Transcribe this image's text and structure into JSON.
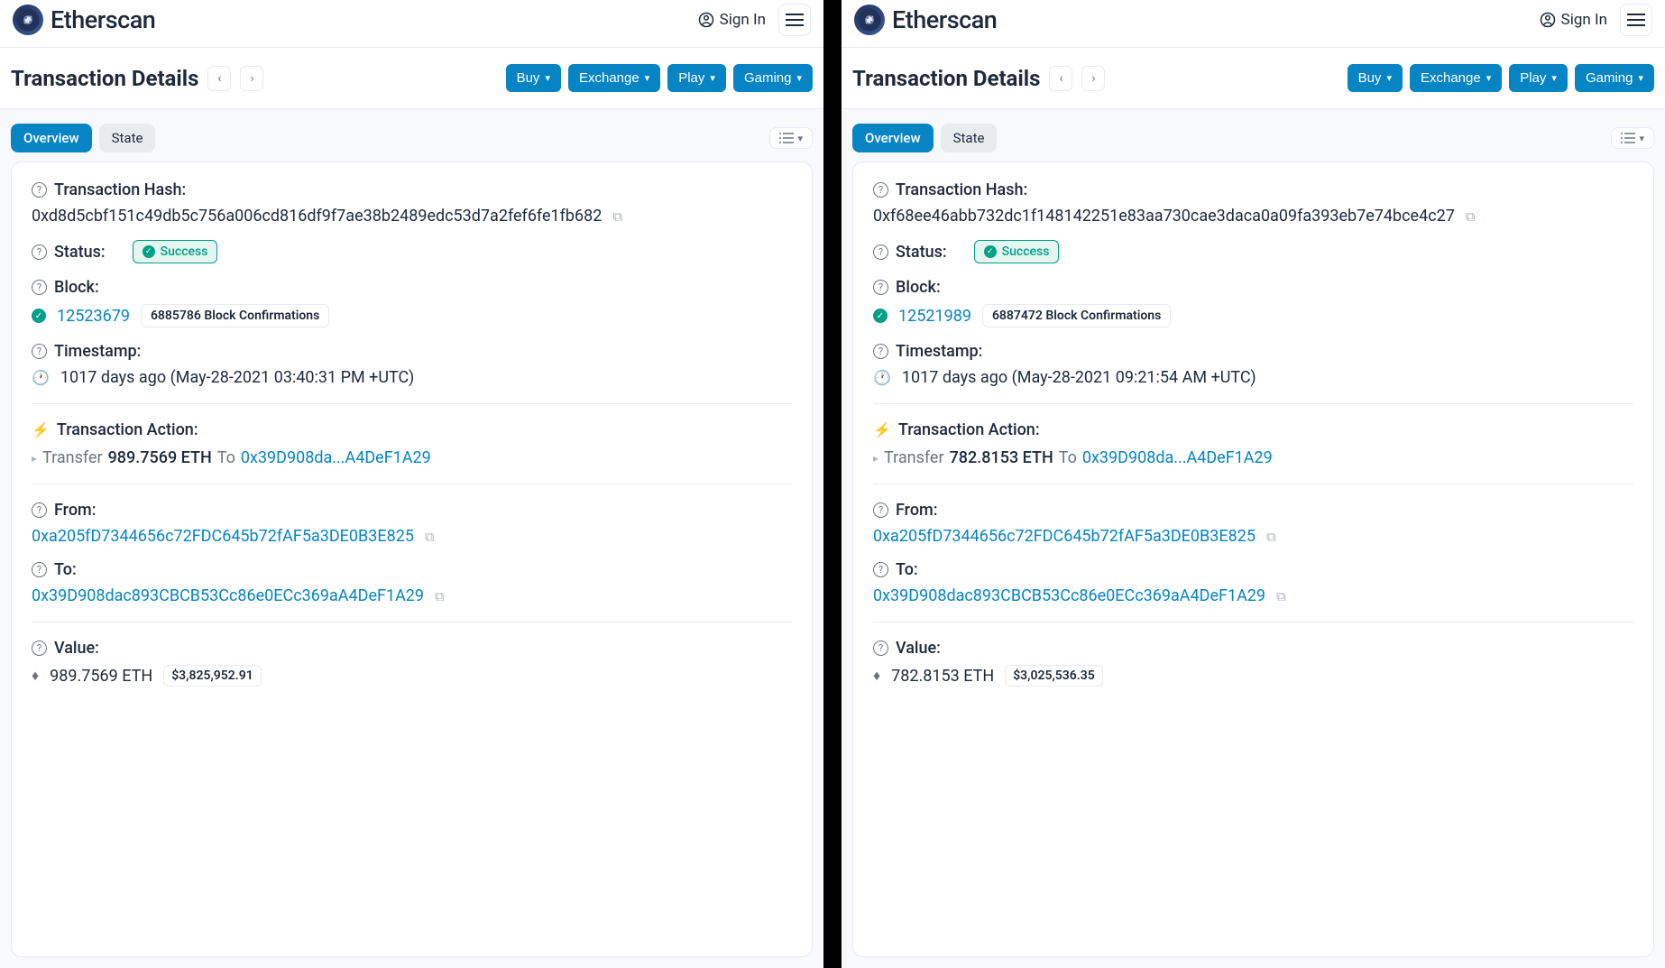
{
  "brand": "Etherscan",
  "signin": "Sign In",
  "page_title": "Transaction Details",
  "header_buttons": {
    "buy": "Buy",
    "exchange": "Exchange",
    "play": "Play",
    "gaming": "Gaming"
  },
  "tabs": {
    "overview": "Overview",
    "state": "State"
  },
  "labels": {
    "tx_hash": "Transaction Hash:",
    "status": "Status:",
    "block": "Block:",
    "timestamp": "Timestamp:",
    "tx_action": "Transaction Action:",
    "from": "From:",
    "to": "To:",
    "value": "Value:"
  },
  "status_text": "Success",
  "action_transfer": "Transfer",
  "action_to": "To",
  "left": {
    "hash": "0xd8d5cbf151c49db5c756a006cd816df9f7ae38b2489edc53d7a2fef6fe1fb682",
    "block": "12523679",
    "confirmations": "6885786 Block Confirmations",
    "timestamp": "1017 days ago (May-28-2021 03:40:31 PM +UTC)",
    "action_amount": "989.7569 ETH",
    "action_to_short": "0x39D908da...A4DeF1A29",
    "from": "0xa205fD7344656c72FDC645b72fAF5a3DE0B3E825",
    "to": "0x39D908dac893CBCB53Cc86e0ECc369aA4DeF1A29",
    "value_eth": "989.7569 ETH",
    "value_usd": "$3,825,952.91"
  },
  "right": {
    "hash": "0xf68ee46abb732dc1f148142251e83aa730cae3daca0a09fa393eb7e74bce4c27",
    "block": "12521989",
    "confirmations": "6887472 Block Confirmations",
    "timestamp": "1017 days ago (May-28-2021 09:21:54 AM +UTC)",
    "action_amount": "782.8153 ETH",
    "action_to_short": "0x39D908da...A4DeF1A29",
    "from": "0xa205fD7344656c72FDC645b72fAF5a3DE0B3E825",
    "to": "0x39D908dac893CBCB53Cc86e0ECc369aA4DeF1A29",
    "value_eth": "782.8153 ETH",
    "value_usd": "$3,025,536.35"
  }
}
